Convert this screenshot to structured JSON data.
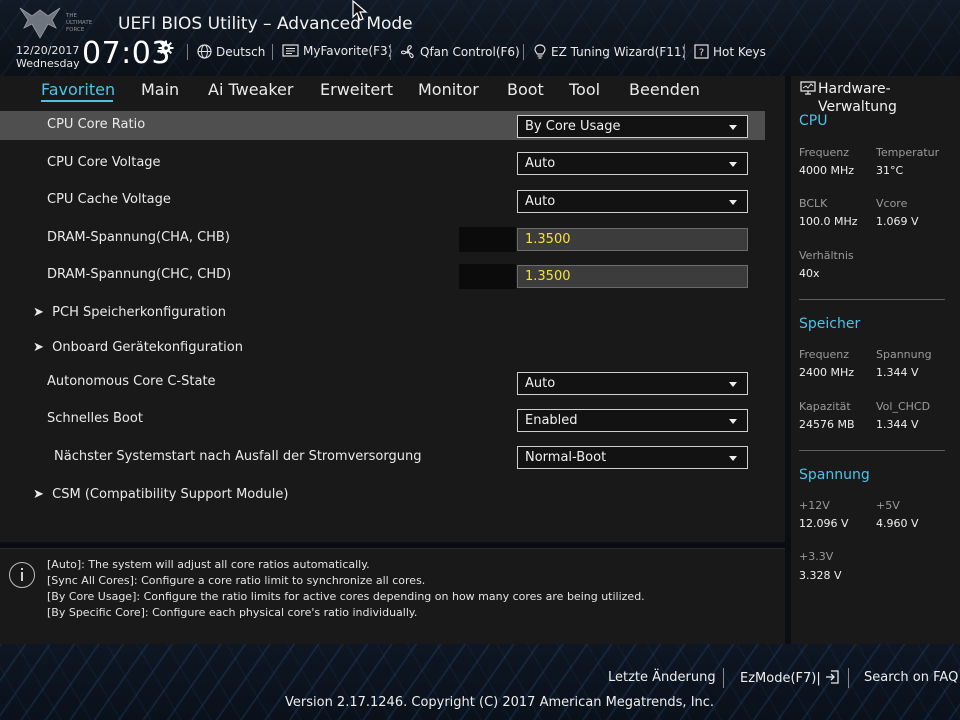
{
  "header": {
    "logo_text": "THE ULTIMATE FORCE",
    "title": "UEFI BIOS Utility – Advanced Mode",
    "date": "12/20/2017",
    "weekday": "Wednesday",
    "time": "07:03",
    "toolbar": [
      {
        "label": "Deutsch",
        "icon": "globe-icon"
      },
      {
        "label": "MyFavorite(F3)",
        "icon": "favorite-icon"
      },
      {
        "label": "Qfan Control(F6)",
        "icon": "fan-icon"
      },
      {
        "label": "EZ Tuning Wizard(F11)",
        "icon": "bulb-icon"
      },
      {
        "label": "Hot Keys",
        "icon": "question-icon"
      }
    ]
  },
  "nav": {
    "tabs": [
      "Favoriten",
      "Main",
      "Ai Tweaker",
      "Erweitert",
      "Monitor",
      "Boot",
      "Tool",
      "Beenden"
    ],
    "active": "Favoriten"
  },
  "settings": [
    {
      "label": "CPU Core Ratio",
      "value": "By Core Usage",
      "type": "dropdown",
      "highlighted": true
    },
    {
      "label": "CPU Core Voltage",
      "value": "Auto",
      "type": "dropdown"
    },
    {
      "label": "CPU Cache Voltage",
      "value": "Auto",
      "type": "dropdown"
    },
    {
      "label": "DRAM-Spannung(CHA, CHB)",
      "value": "1.3500",
      "type": "input"
    },
    {
      "label": "DRAM-Spannung(CHC, CHD)",
      "value": "1.3500",
      "type": "input"
    },
    {
      "label": "PCH Speicherkonfiguration",
      "type": "submenu"
    },
    {
      "label": "Onboard Gerätekonfiguration",
      "type": "submenu"
    },
    {
      "label": "Autonomous Core C-State",
      "value": "Auto",
      "type": "dropdown"
    },
    {
      "label": "Schnelles Boot",
      "value": "Enabled",
      "type": "dropdown"
    },
    {
      "label": "Nächster Systemstart nach Ausfall der Stromversorgung",
      "value": "Normal-Boot",
      "type": "dropdown"
    },
    {
      "label": "CSM (Compatibility Support Module)",
      "type": "submenu"
    }
  ],
  "help": [
    "[Auto]: The system will adjust all core ratios automatically.",
    "[Sync All Cores]: Configure a core ratio limit to synchronize all cores.",
    "[By Core Usage]: Configure the ratio limits for active cores depending on how many cores are being utilized.",
    "[By Specific Core]: Configure each physical core's ratio individually."
  ],
  "hw": {
    "title": "Hardware-Verwaltung",
    "cpu": {
      "title": "CPU",
      "freq_label": "Frequenz",
      "freq": "4000 MHz",
      "temp_label": "Temperatur",
      "temp": "31°C",
      "bclk_label": "BCLK",
      "bclk": "100.0 MHz",
      "vcore_label": "Vcore",
      "vcore": "1.069 V",
      "ratio_label": "Verhältnis",
      "ratio": "40x"
    },
    "mem": {
      "title": "Speicher",
      "freq_label": "Frequenz",
      "freq": "2400 MHz",
      "volt_label": "Spannung",
      "volt": "1.344 V",
      "cap_label": "Kapazität",
      "cap": "24576 MB",
      "vchcd_label": "Vol_CHCD",
      "vchcd": "1.344 V"
    },
    "volt": {
      "title": "Spannung",
      "v12_label": "+12V",
      "v12": "12.096 V",
      "v5_label": "+5V",
      "v5": "4.960 V",
      "v33_label": "+3.3V",
      "v33": "3.328 V"
    }
  },
  "footer": {
    "last_change": "Letzte Änderung",
    "ezmode": "EzMode(F7)|",
    "faq": "Search on FAQ",
    "version": "Version 2.17.1246. Copyright (C) 2017 American Megatrends, Inc."
  },
  "colors": {
    "accent": "#4cc3ea",
    "value_yellow": "#f5e13a",
    "highlight": "#4f4f4f"
  }
}
